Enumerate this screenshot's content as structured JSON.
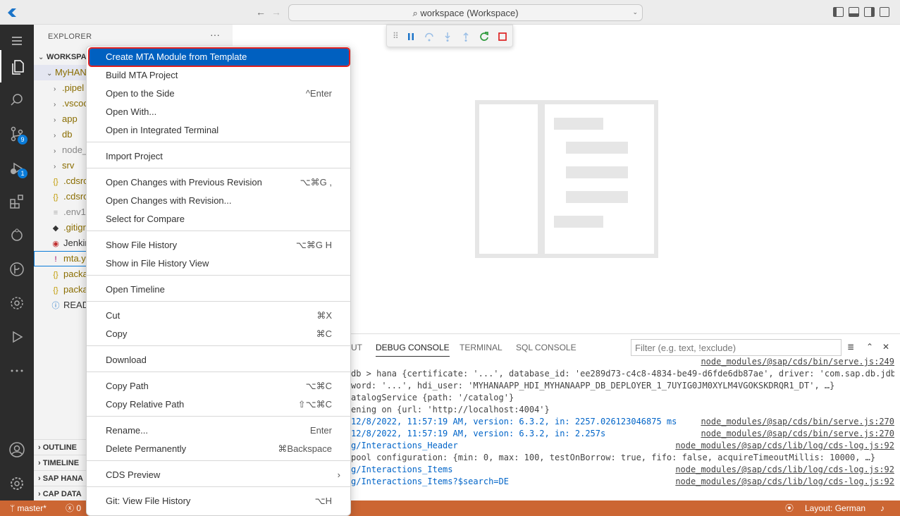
{
  "titlebar": {
    "search_text": "workspace (Workspace)"
  },
  "activitybar": {
    "scm_badge": "9",
    "debug_badge": "1"
  },
  "explorer": {
    "title": "EXPLORER",
    "more": "···",
    "workspace_label": "WORKSPA",
    "project_label": "MyHAN",
    "items": [
      {
        "label": ".pipel"
      },
      {
        "label": ".vscoc"
      },
      {
        "label": "app"
      },
      {
        "label": "db"
      },
      {
        "label": "node_"
      },
      {
        "label": "srv"
      },
      {
        "label": ".cdsrc"
      },
      {
        "label": ".cdsrc"
      },
      {
        "label": ".env1"
      },
      {
        "label": ".gitigr"
      },
      {
        "label": "Jenkin"
      },
      {
        "label": "mta.y"
      },
      {
        "label": "packa"
      },
      {
        "label": "packa"
      },
      {
        "label": "READ"
      }
    ],
    "sections": [
      "OUTLINE",
      "TIMELINE",
      "SAP HANA",
      "CAP DATA"
    ]
  },
  "context_menu": {
    "items": [
      {
        "label": "Create MTA Module from Template",
        "shortcut": ""
      },
      {
        "label": "Build MTA Project",
        "shortcut": ""
      },
      {
        "label": "Open to the Side",
        "shortcut": "^Enter"
      },
      {
        "label": "Open With...",
        "shortcut": ""
      },
      {
        "label": "Open in Integrated Terminal",
        "shortcut": ""
      },
      {
        "label": "Import Project",
        "shortcut": ""
      },
      {
        "label": "Open Changes with Previous Revision",
        "shortcut": "⌥⌘G ,"
      },
      {
        "label": "Open Changes with Revision...",
        "shortcut": ""
      },
      {
        "label": "Select for Compare",
        "shortcut": ""
      },
      {
        "label": "Show File History",
        "shortcut": "⌥⌘G H"
      },
      {
        "label": "Show in File History View",
        "shortcut": ""
      },
      {
        "label": "Open Timeline",
        "shortcut": ""
      },
      {
        "label": "Cut",
        "shortcut": "⌘X"
      },
      {
        "label": "Copy",
        "shortcut": "⌘C"
      },
      {
        "label": "Download",
        "shortcut": ""
      },
      {
        "label": "Copy Path",
        "shortcut": "⌥⌘C"
      },
      {
        "label": "Copy Relative Path",
        "shortcut": "⇧⌥⌘C"
      },
      {
        "label": "Rename...",
        "shortcut": "Enter"
      },
      {
        "label": "Delete Permanently",
        "shortcut": "⌘Backspace"
      },
      {
        "label": "CDS Preview",
        "shortcut": "›"
      },
      {
        "label": "Git: View File History",
        "shortcut": "⌥H"
      }
    ]
  },
  "panel": {
    "tabs": [
      "UT",
      "DEBUG CONSOLE",
      "TERMINAL",
      "SQL CONSOLE"
    ],
    "filter_placeholder": "Filter (e.g. text, !exclude)",
    "log": [
      {
        "msg": "",
        "src": "node_modules/@sap/cds/bin/serve.js:249",
        "blue": false
      },
      {
        "msg": "db > hana {certificate: '...', database_id: 'ee289d73-c4c8-4834-be49-d6fde6db87ae', driver: 'com.sap.db.jdb",
        "src": "",
        "blue": false
      },
      {
        "msg": "word: '...', hdi_user: 'MYHANAAPP_HDI_MYHANAAPP_DB_DEPLOYER_1_7UYIG0JM0XYLM4VGOKSKDRQR1_DT', …}",
        "src": "",
        "blue": false
      },
      {
        "msg": "atalogService {path: '/catalog'}",
        "src": "",
        "blue": false
      },
      {
        "msg": "ening on {url: 'http://localhost:4004'}",
        "src": "",
        "blue": false
      },
      {
        "msg": " 12/8/2022, 11:57:19 AM, version: 6.3.2, in: 2257.026123046875 ms",
        "src": "node_modules/@sap/cds/bin/serve.js:270",
        "blue": true
      },
      {
        "msg": " 12/8/2022, 11:57:19 AM, version: 6.3.2, in: 2.257s",
        "src": "node_modules/@sap/cds/bin/serve.js:270",
        "blue": true
      },
      {
        "msg": "g/Interactions_Header",
        "src": "node_modules/@sap/cds/lib/log/cds-log.js:92",
        "blue": true
      },
      {
        "msg": "pool configuration: {min: 0, max: 100, testOnBorrow: true, fifo: false, acquireTimeoutMillis: 10000, …}",
        "src": "",
        "blue": false
      },
      {
        "msg": "g/Interactions_Items",
        "src": "node_modules/@sap/cds/lib/log/cds-log.js:92",
        "blue": true
      },
      {
        "msg": "g/Interactions_Items?$search=DE",
        "src": "node_modules/@sap/cds/lib/log/cds-log.js:92",
        "blue": true
      }
    ]
  },
  "statusbar": {
    "branch": "master*",
    "errors": "0",
    "layout": "Layout: German"
  }
}
